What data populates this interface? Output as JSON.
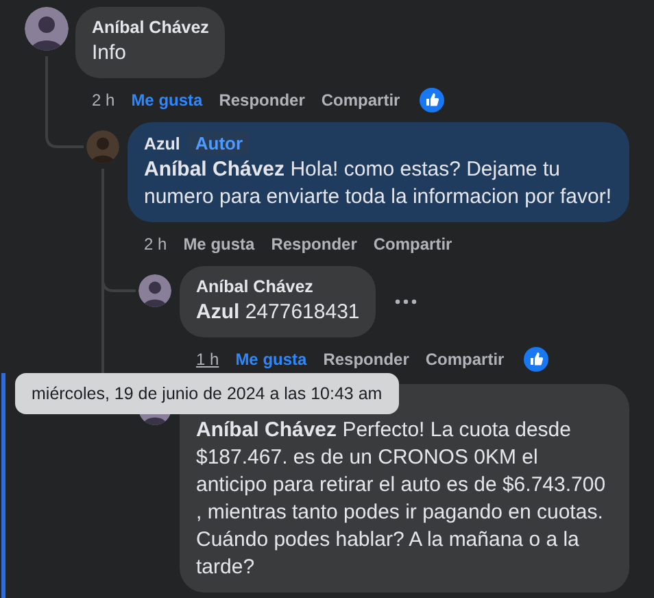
{
  "comments": [
    {
      "author": "Aníbal Chávez",
      "text": "Info",
      "time": "2 h",
      "like_label": "Me gusta",
      "reply_label": "Responder",
      "share_label": "Compartir",
      "liked": true,
      "reaction": true,
      "highlighted": false,
      "focused": false,
      "show_menu": false,
      "children": [
        {
          "author": "Azul",
          "badge": "Autor",
          "text": "**Aníbal Chávez** Hola! como estas? Dejame tu numero para enviarte toda la informacion por favor!",
          "time": "2 h",
          "like_label": "Me gusta",
          "reply_label": "Responder",
          "share_label": "Compartir",
          "liked": false,
          "reaction": false,
          "highlighted": true,
          "focused": false,
          "show_menu": false,
          "children": [
            {
              "author": "Aníbal Chávez",
              "text": "**Azul** 2477618431",
              "time": "1 h",
              "like_label": "Me gusta",
              "reply_label": "Responder",
              "share_label": "Compartir",
              "liked": true,
              "reaction": true,
              "highlighted": false,
              "focused": false,
              "show_menu": true,
              "tooltip": "miércoles, 19 de junio de 2024 a las 10:43 am"
            },
            {
              "text": "**Aníbal Chávez** Perfecto! La cuota desde $187.467. es de un CRONOS 0KM el anticipo para retirar el auto es de $6.743.700 , mientras tanto podes ir pagando en cuotas. Cuándo podes hablar? A la mañana o a la tarde?",
              "highlighted": false,
              "focused": true,
              "show_menu": false
            }
          ]
        }
      ]
    }
  ]
}
